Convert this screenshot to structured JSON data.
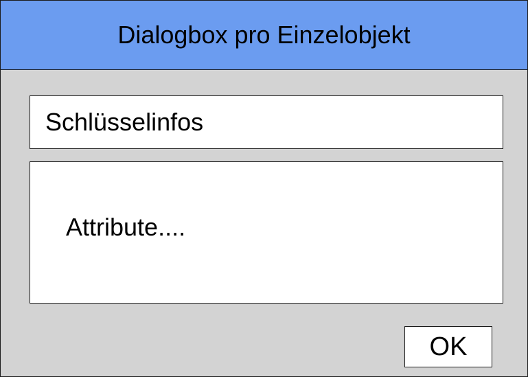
{
  "dialog": {
    "title": "Dialogbox pro Einzelobjekt",
    "key_info_label": "Schlüsselinfos",
    "attributes_label": "Attribute....",
    "ok_label": "OK"
  },
  "colors": {
    "titlebar": "#6b9cf0",
    "dialog_background": "#d3d3d3",
    "panel_background": "#ffffff",
    "border": "#1a1a1a"
  }
}
